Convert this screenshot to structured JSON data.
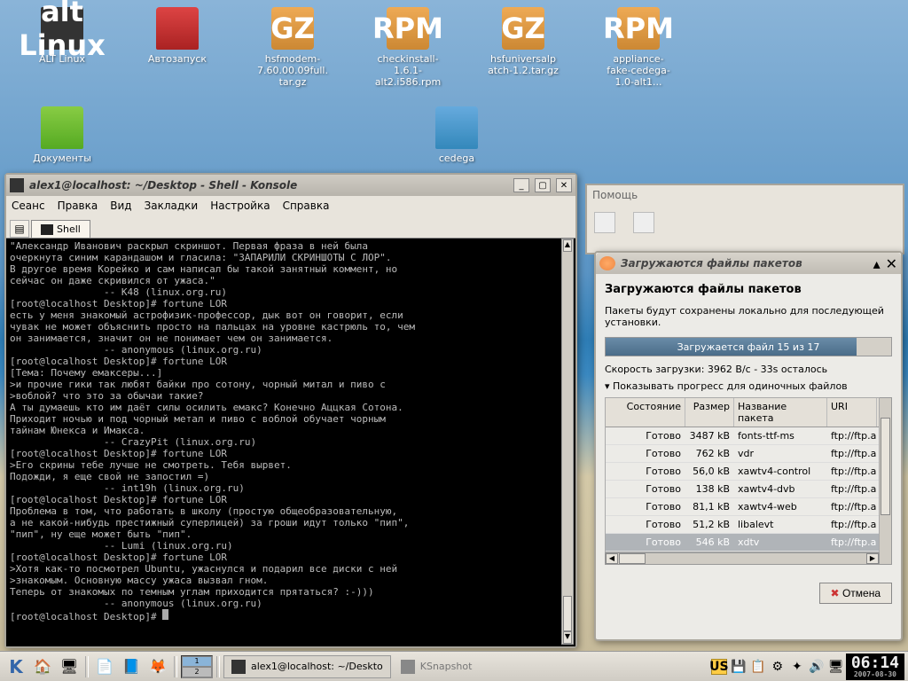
{
  "desktop": {
    "row1": [
      {
        "label": "ALT Linux",
        "type": "alt"
      },
      {
        "label": "Автозапуск",
        "type": "folder-red"
      },
      {
        "label": "hsfmodem-7.60.00.09full.tar.gz",
        "type": "gz"
      },
      {
        "label": "checkinstall-1.6.1-alt2.i586.rpm",
        "type": "rpm"
      },
      {
        "label": "hsfuniversalpatch-1.2.tar.gz",
        "type": "gz"
      },
      {
        "label": "appliance-fake-cedega-1.0-alt1...",
        "type": "rpm"
      }
    ],
    "row2": [
      {
        "label": "Документы",
        "type": "folder-green"
      },
      {
        "label": "cedega",
        "type": "folder-blue"
      }
    ]
  },
  "konsole": {
    "title": "alex1@localhost: ~/Desktop - Shell - Konsole",
    "menus": [
      "Сеанс",
      "Правка",
      "Вид",
      "Закладки",
      "Настройка",
      "Справка"
    ],
    "tab": "Shell",
    "content": "\"Александр Иванович раскрыл скриншот. Первая фраза в ней была\nочеркнута синим карандашом и гласила: \"ЗАПАРИЛИ СКРИНШОТЫ С ЛОР\".\nВ другое время Корейко и сам написал бы такой занятный коммент, но\nсейчас он даже скривился от ужаса.\"\n                -- K48 (linux.org.ru)\n[root@localhost Desktop]# fortune LOR\nесть у меня знакомый астрофизик-профессор, дык вот он говорит, если\nчувак не может объяснить просто на пальцах на уровне кастрюль то, чем\nон занимается, значит он не понимает чем он занимается.\n                -- anonymous (linux.org.ru)\n[root@localhost Desktop]# fortune LOR\n[Тема: Почему емаксеры...]\n>и прочие гики так любят байки про сотону, чорный митал и пиво с\n>воблой? что это за обычаи такие?\nА ты думаешь кто им даёт силы осилить емакс? Конечно Аццкая Сотона.\nПриходит ночью и под чорный метал и пиво с воблой обучает чорным\nтайнам Юнекса и Имакса.\n                -- CrazyPit (linux.org.ru)\n[root@localhost Desktop]# fortune LOR\n>Его скрины тебе лучше не смотреть. Тебя вырвет.\nПодожди, я еще свой не запостил =)\n                -- int19h (linux.org.ru)\n[root@localhost Desktop]# fortune LOR\nПроблема в том, что работать в школу (простую общеобразовательную,\nа не какой-нибудь престижный суперлицей) за гроши идут только \"пип\",\n\"пип\", ну еще может быть \"пип\".\n                -- Lumi (linux.org.ru)\n[root@localhost Desktop]# fortune LOR\n>Хотя как-то посмотрел Ubuntu, ужаснулся и подарил все диски с ней\n>знакомым. Основную массу ужаса вызвал гном.\nТеперь от знакомых по темным углам приходится прятаться? :-)))\n                -- anonymous (linux.org.ru)\n[root@localhost Desktop]# "
  },
  "synaptic": {
    "help": "Помощь"
  },
  "dialog": {
    "title": "Загружаются файлы пакетов",
    "heading": "Загружаются файлы пакетов",
    "desc": "Пакеты будут сохранены локально для последующей установки.",
    "progress_label": "Загружается файл 15 из 17",
    "speed": "Скорость загрузки: 3962  В/с - 33s осталось",
    "expander": "Показывать прогресс для одиночных файлов",
    "cols": [
      "Состояние",
      "Размер",
      "Название пакета",
      "URI"
    ],
    "rows": [
      {
        "s": "Готово",
        "sz": "3487 kB",
        "n": "fonts-ttf-ms",
        "u": "ftp://ftp.a"
      },
      {
        "s": "Готово",
        "sz": "762 kB",
        "n": "vdr",
        "u": "ftp://ftp.a"
      },
      {
        "s": "Готово",
        "sz": "56,0 kB",
        "n": "xawtv4-control",
        "u": "ftp://ftp.a"
      },
      {
        "s": "Готово",
        "sz": "138 kB",
        "n": "xawtv4-dvb",
        "u": "ftp://ftp.a"
      },
      {
        "s": "Готово",
        "sz": "81,1 kB",
        "n": "xawtv4-web",
        "u": "ftp://ftp.a"
      },
      {
        "s": "Готово",
        "sz": "51,2 kB",
        "n": "libalevt",
        "u": "ftp://ftp.a"
      },
      {
        "s": "Готово",
        "sz": "546 kB",
        "n": "xdtv",
        "u": "ftp://ftp.a",
        "sel": true
      }
    ],
    "cancel": "Отмена"
  },
  "taskbar": {
    "pager": [
      "1",
      "2"
    ],
    "task1": "alex1@localhost: ~/Deskto",
    "task2": "KSnapshot",
    "layout": "US",
    "time": "06:14",
    "date": "2007-08-30"
  }
}
